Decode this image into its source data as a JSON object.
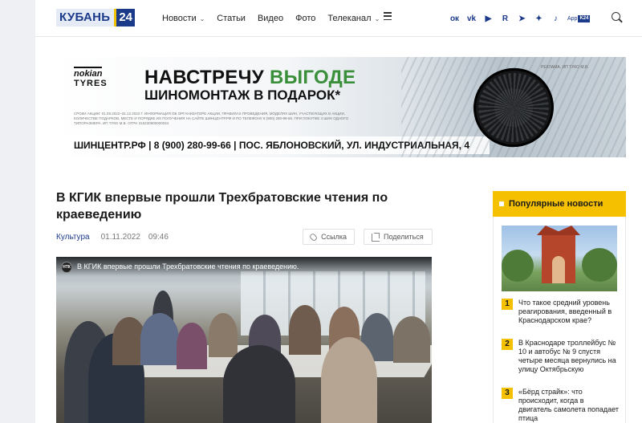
{
  "header": {
    "logo_text": "КУБАНЬ",
    "logo_num": "24",
    "nav": [
      {
        "label": "Новости",
        "dropdown": true
      },
      {
        "label": "Статьи",
        "dropdown": false
      },
      {
        "label": "Видео",
        "dropdown": false
      },
      {
        "label": "Фото",
        "dropdown": false
      },
      {
        "label": "Телеканал",
        "dropdown": true
      }
    ],
    "socials": [
      "ok-icon",
      "vk-icon",
      "youtube-icon",
      "rutube-icon",
      "telegram-icon",
      "zen-icon",
      "tiktok-icon"
    ],
    "social_glyphs": [
      "ок",
      "vk",
      "▶",
      "R",
      "➤",
      "✦",
      "♪"
    ],
    "app_label": "App",
    "app_badge": "K24"
  },
  "banner": {
    "brand_line1": "nokian",
    "brand_line2": "TYRES",
    "headline_part1": "НАВСТРЕЧУ ",
    "headline_part2": "ВЫГОДЕ",
    "headline2": "ШИНОМОНТАЖ В ПОДАРОК*",
    "ad_label": "РЕКЛАМА. ИП ТУКО М.В.",
    "fine_print": "СРОКИ АКЦИИ: 01.09.2022–31.12.2022 Г. ИНФОРМАЦИЯ ОБ ОРГАНИЗАТОРЕ АКЦИИ, ПРАВИЛАХ ПРОВЕДЕНИЯ, МОДЕЛЯХ ШИН, УЧАСТВУЮЩИХ В АКЦИИ, КОЛИЧЕСТВЕ ПОДАРКОВ, МЕСТЕ И ПОРЯДКЕ ИХ ПОЛУЧЕНИЯ НА САЙТЕ ШИНЦЕНТР.РФ И ПО ТЕЛЕФОНУ 8 (900) 280-99-66. ПРИ ПОКУПКЕ 4 ШИН ОДНОГО ТИПОРАЗМЕРА. ИП ТУКО М.В. ОГРН 315230900000034",
    "contacts": "ШИНЦЕНТР.РФ  |  8 (900) 280-99-66  |  ПОС. ЯБЛОНОВСКИЙ, УЛ. ИНДУСТРИАЛЬНАЯ, 4",
    "accent_color": "#3a8f3a"
  },
  "article": {
    "title": "В КГИК впервые прошли Трехбратовские чтения по краеведению",
    "category": "Культура",
    "date": "01.11.2022",
    "time": "09:46",
    "link_button": "Ссылка",
    "share_button": "Поделиться",
    "video_channel": "НТК",
    "video_title": "В КГИК впервые прошли Трехбратовские чтения по краеведению."
  },
  "sidebar": {
    "heading": "Популярные новости",
    "accent_color": "#f5c000",
    "items": [
      {
        "num": "1",
        "text": "Что такое средний уровень реагирования, введенный в Краснодарском крае?"
      },
      {
        "num": "2",
        "text": "В Краснодаре троллейбус № 10 и автобус № 9 спустя четыре месяца вернулись на улицу Октябрьскую"
      },
      {
        "num": "3",
        "text": "«Бёрд страйк»: что происходит, когда в двигатель самолета попадает птица"
      }
    ]
  }
}
